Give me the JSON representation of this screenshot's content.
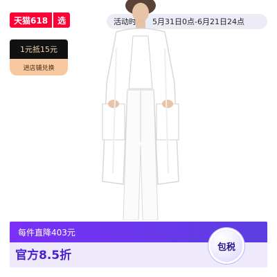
{
  "badges": {
    "tmall_label": "天猫618",
    "select_label": "选"
  },
  "activity": {
    "label": "活动时间",
    "value": "5月31日0点-6月21日24点"
  },
  "coupon": {
    "title": "1元抵15元",
    "action": "进店铺兑换"
  },
  "banner": {
    "top_text": "每件直降403元",
    "price_text": "官方8.5折",
    "tax_badge": "包税"
  },
  "product": {
    "icon": "white-long-cardigan-illustration"
  }
}
